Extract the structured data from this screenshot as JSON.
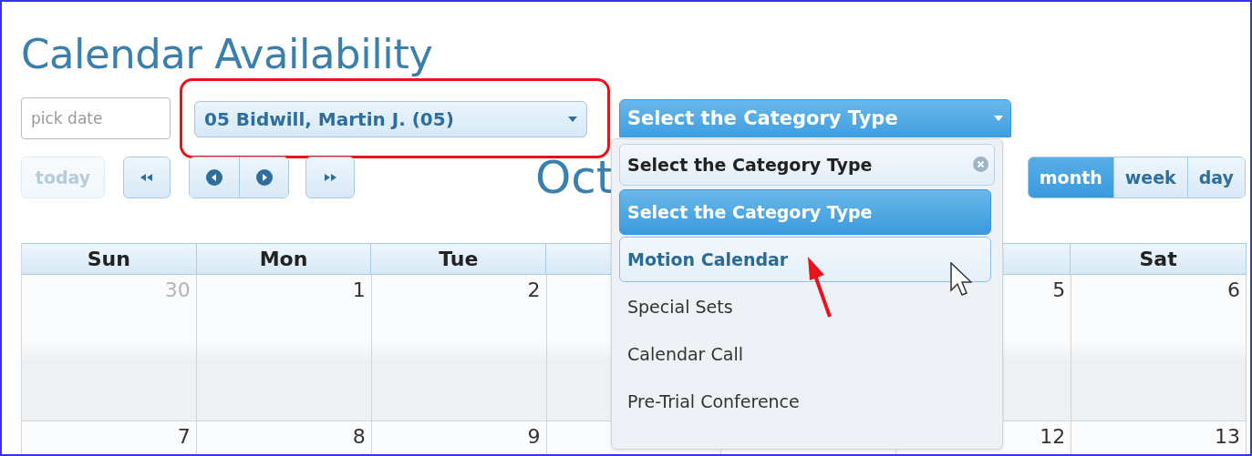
{
  "title": "Calendar Availability",
  "date_field": {
    "placeholder": "pick date"
  },
  "judge_select": {
    "value": "05 Bidwill, Martin J. (05)",
    "highlighted": true
  },
  "category_select": {
    "value": "Select the Category Type",
    "open": true,
    "search": {
      "value": "Select the Category Type"
    },
    "options": [
      {
        "label": "Select the Category Type",
        "selected": true,
        "hovered": false
      },
      {
        "label": "Motion Calendar",
        "selected": false,
        "hovered": true
      },
      {
        "label": "Special Sets",
        "selected": false,
        "hovered": false
      },
      {
        "label": "Calendar Call",
        "selected": false,
        "hovered": false
      },
      {
        "label": "Pre-Trial Conference",
        "selected": false,
        "hovered": false
      }
    ]
  },
  "toolbar": {
    "today": {
      "label": "today",
      "disabled": true
    },
    "month_title": "Oct",
    "views": [
      {
        "label": "month",
        "selected": true
      },
      {
        "label": "week",
        "selected": false
      },
      {
        "label": "day",
        "selected": false
      }
    ]
  },
  "calendar": {
    "columns": {
      "left": [
        "Sun",
        "Mon",
        "Tue"
      ],
      "right": [
        "Sat"
      ]
    },
    "weeks": [
      {
        "left": [
          {
            "day": "30",
            "other_month": true
          },
          {
            "day": "1",
            "other_month": false
          },
          {
            "day": "2",
            "other_month": false
          }
        ],
        "right": [
          {
            "day": "5",
            "other_month": false
          },
          {
            "day": "6",
            "other_month": false
          }
        ]
      },
      {
        "left": [
          {
            "day": "7",
            "other_month": false
          },
          {
            "day": "8",
            "other_month": false
          },
          {
            "day": "9",
            "other_month": false
          }
        ],
        "right": [
          {
            "day": "12",
            "other_month": false
          },
          {
            "day": "13",
            "other_month": false
          }
        ]
      }
    ]
  }
}
